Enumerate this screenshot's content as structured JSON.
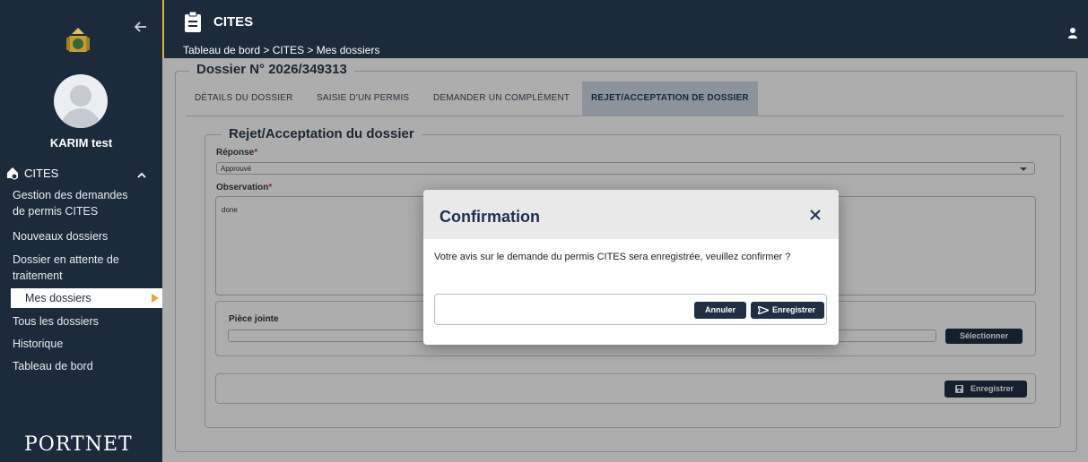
{
  "sidebar": {
    "user_name": "KARIM test",
    "section_label": "CITES",
    "items": [
      {
        "label_line1": "Gestion des demandes",
        "label_line2": "de permis CITES"
      },
      {
        "label_line1": "Nouveaux dossiers"
      },
      {
        "label_line1": "Dossier en attente de",
        "label_line2": "traitement"
      },
      {
        "label_line1": "Mes dossiers",
        "active": true
      },
      {
        "label_line1": "Tous les dossiers"
      },
      {
        "label_line1": "Historique"
      },
      {
        "label_line1": "Tableau de bord"
      }
    ],
    "logo_text": "PORTNET",
    "icons": [
      "back-arrow-icon",
      "royal-emblem-icon",
      "user-avatar-icon",
      "cites-section-icon",
      "chevron-up-icon",
      "active-arrow-icon"
    ]
  },
  "header": {
    "title": "CITES",
    "breadcrumb": "Tableau de bord > CITES > Mes dossiers",
    "icons": [
      "clipboard-icon",
      "user-icon"
    ]
  },
  "main": {
    "dossier_legend": "Dossier N° 2026/349313",
    "tabs": [
      {
        "label": "DÉTAILS DU DOSSIER"
      },
      {
        "label": "SAISIE D'UN PERMIS"
      },
      {
        "label": "DEMANDER UN COMPLÉMENT"
      },
      {
        "label": "REJET/ACCEPTATION DE DOSSIER",
        "active": true
      }
    ],
    "decision_legend": "Rejet/Acceptation du dossier",
    "reponse_label": "Réponse",
    "reponse_value": "Approuvé",
    "observation_label": "Observation",
    "observation_value": "done",
    "required_mark": "*",
    "piece_label": "Pièce jointe",
    "select_button": "Sélectionner",
    "save_button": "Enregistrer"
  },
  "modal": {
    "title": "Confirmation",
    "message": "Votre avis sur le demande du permis CITES sera enregistrée, veuillez confirmer ?",
    "cancel_button": "Annuler",
    "confirm_button": "Enregistrer",
    "icons": [
      "close-icon",
      "send-icon"
    ]
  },
  "colors": {
    "sidebar_bg": "#1b2b3c",
    "header_accent": "#e3b03b",
    "active_arrow": "#f0a33a",
    "button_bg": "#1e2f46",
    "active_tab_bg": "#cfd9e6",
    "modal_title": "#1e2f55"
  }
}
